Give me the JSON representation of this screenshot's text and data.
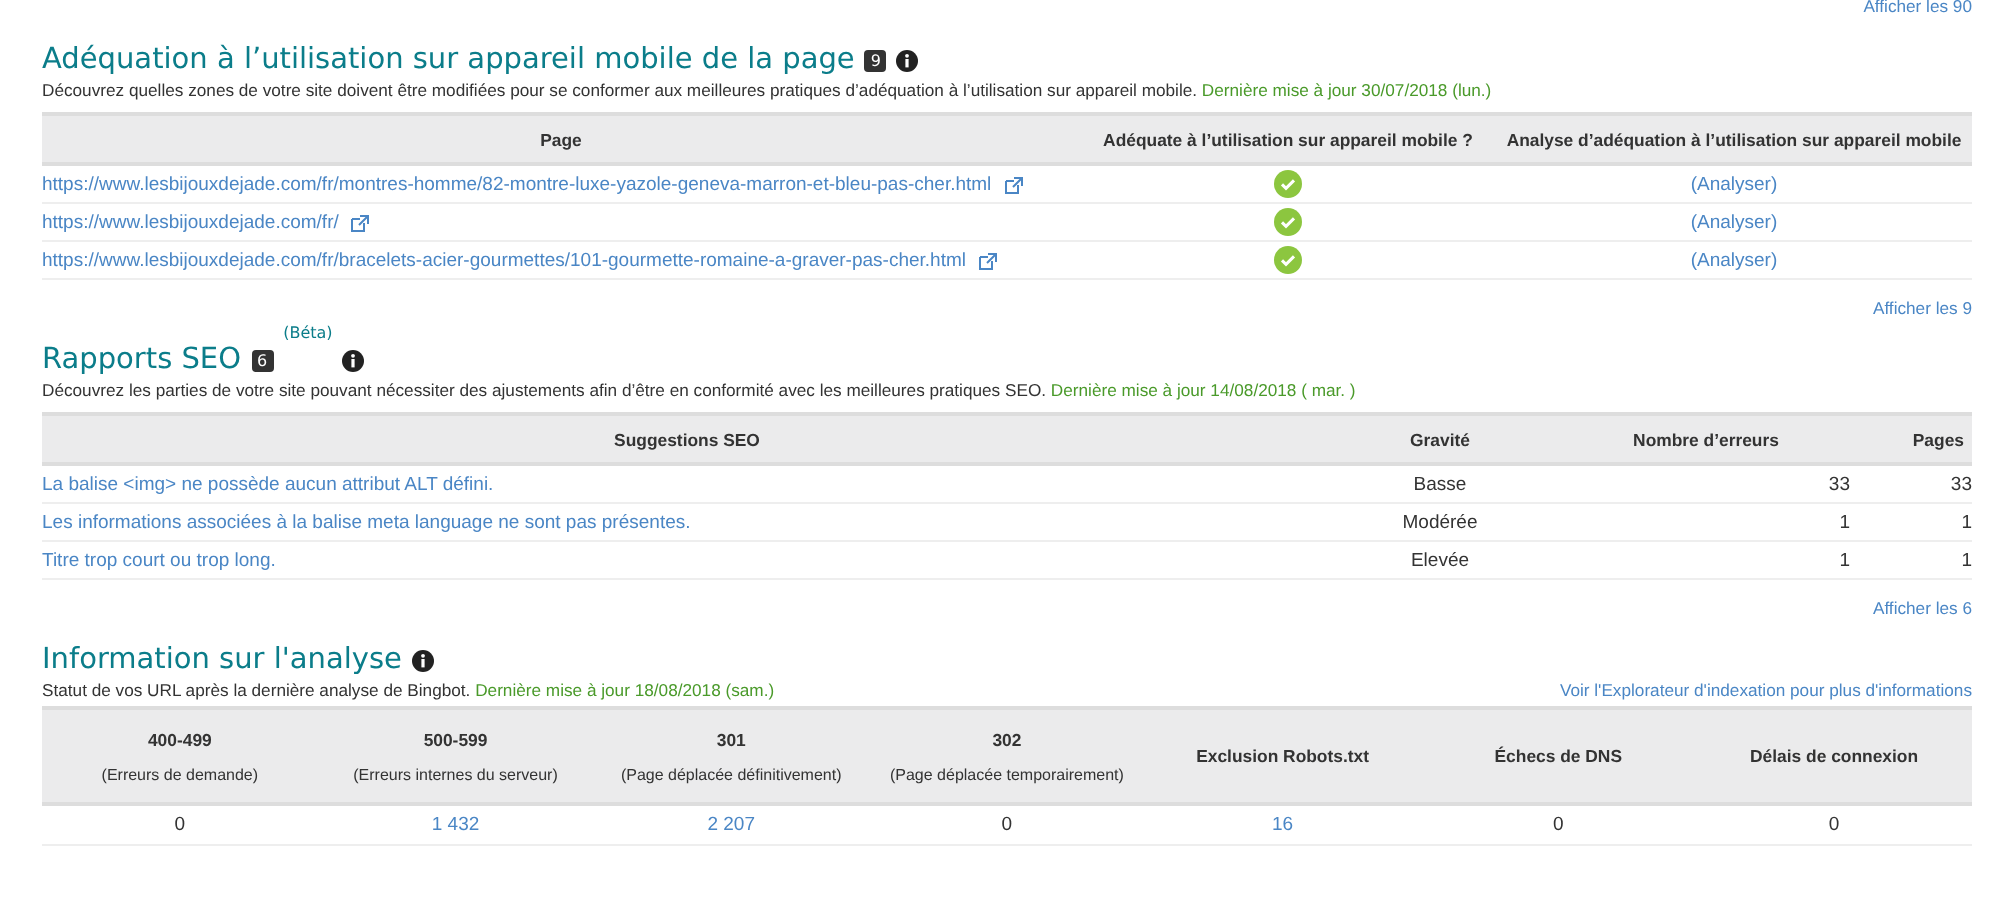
{
  "top_link": "Afficher les 90",
  "mobile": {
    "title": "Adéquation à l’utilisation sur appareil mobile de la page",
    "badge": "9",
    "description": "Découvrez quelles zones de votre site doivent être modifiées pour se conformer aux meilleures pratiques d’adéquation à l’utilisation sur appareil mobile.",
    "updated": "Dernière mise à jour 30/07/2018 (lun.)",
    "columns": [
      "Page",
      "Adéquate à l’utilisation sur appareil mobile ?",
      "Analyse d’adéquation à l’utilisation sur appareil mobile"
    ],
    "rows": [
      {
        "url": "https://www.lesbijouxdejade.com/fr/montres-homme/82-montre-luxe-yazole-geneva-marron-et-bleu-pas-cher.html",
        "mobile_friendly": true,
        "action": "(Analyser)"
      },
      {
        "url": "https://www.lesbijouxdejade.com/fr/",
        "mobile_friendly": true,
        "action": "(Analyser)"
      },
      {
        "url": "https://www.lesbijouxdejade.com/fr/bracelets-acier-gourmettes/101-gourmette-romaine-a-graver-pas-cher.html",
        "mobile_friendly": true,
        "action": "(Analyser)"
      }
    ],
    "more": "Afficher les 9"
  },
  "seo": {
    "title": "Rapports SEO",
    "badge": "6",
    "tag": "(Béta)",
    "description": "Découvrez les parties de votre site pouvant nécessiter des ajustements afin d’être en conformité avec les meilleures pratiques SEO.",
    "updated": "Dernière mise à jour 14/08/2018 ( mar. )",
    "columns": [
      "Suggestions SEO",
      "Gravité",
      "Nombre d’erreurs",
      "Pages"
    ],
    "rows": [
      {
        "suggestion": "La balise <img> ne possède aucun attribut ALT défini.",
        "severity": "Basse",
        "errors": "33",
        "pages": "33"
      },
      {
        "suggestion": "Les informations associées à la balise meta language ne sont pas présentes.",
        "severity": "Modérée",
        "errors": "1",
        "pages": "1"
      },
      {
        "suggestion": "Titre trop court ou trop long.",
        "severity": "Elevée",
        "errors": "1",
        "pages": "1"
      }
    ],
    "more": "Afficher les 6"
  },
  "crawl": {
    "title": "Information sur l'analyse",
    "description": "Statut de vos URL après la dernière analyse de Bingbot.",
    "updated": "Dernière mise à jour 18/08/2018 (sam.)",
    "link": "Voir l'Explorateur d'indexation pour plus d'informations",
    "columns": [
      {
        "label": "400-499",
        "sub": "(Erreurs de demande)",
        "value": "0",
        "linked": false
      },
      {
        "label": "500-599",
        "sub": "(Erreurs internes du serveur)",
        "value": "1 432",
        "linked": true
      },
      {
        "label": "301",
        "sub": "(Page déplacée définitivement)",
        "value": "2 207",
        "linked": true
      },
      {
        "label": "302",
        "sub": "(Page déplacée temporairement)",
        "value": "0",
        "linked": false
      },
      {
        "label": "Exclusion Robots.txt",
        "value": "16",
        "linked": true
      },
      {
        "label": "Échecs de DNS",
        "value": "0",
        "linked": false
      },
      {
        "label": "Délais de connexion",
        "value": "0",
        "linked": false
      }
    ]
  }
}
